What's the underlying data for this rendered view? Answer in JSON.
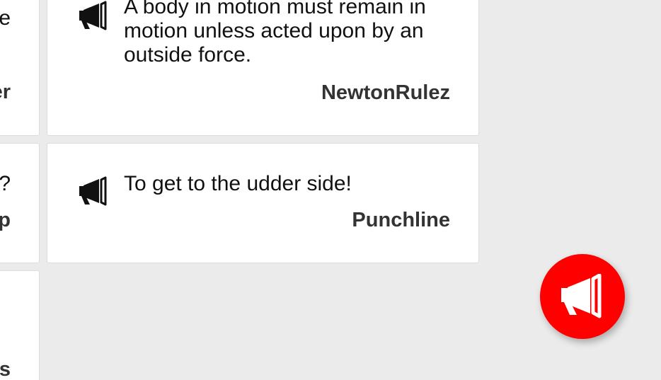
{
  "app": {
    "accent_color": "#ff0000",
    "background_color": "#ebebeb"
  },
  "left_column": {
    "cards": [
      {
        "text_fragment": "e",
        "author_fragment": "er"
      },
      {
        "text_fragment": "?",
        "author_fragment": "p"
      },
      {
        "text_fragment": "",
        "author_fragment": "s"
      }
    ]
  },
  "quotes": [
    {
      "icon": "megaphone-icon",
      "text": "A body in motion must remain in motion unless acted upon by an outside force.",
      "author": "NewtonRulez"
    },
    {
      "icon": "megaphone-icon",
      "text": "To get to the udder side!",
      "author": "Punchline"
    }
  ],
  "fab": {
    "icon": "megaphone-icon",
    "color": "#ff0000",
    "icon_color": "#ffffff"
  }
}
